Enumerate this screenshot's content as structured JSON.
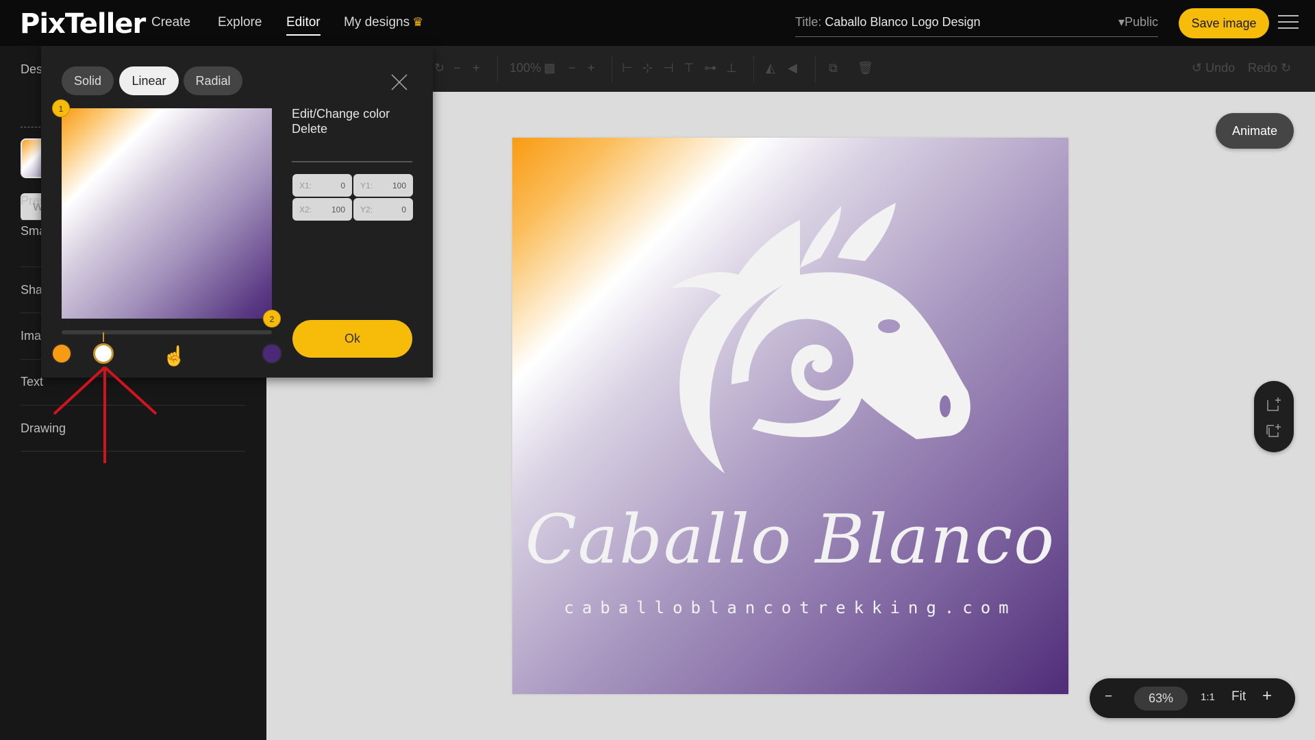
{
  "app": {
    "logo": "PixTeller",
    "nav": [
      "Create",
      "Explore",
      "Editor",
      "My designs"
    ],
    "active_nav": "Editor",
    "title_label": "Title:",
    "title_value": "Caballo Blanco Logo Design",
    "visibility": "Public",
    "save_label": "Save image"
  },
  "toolbar": {
    "zoom_value": "100%",
    "undo_label": "Undo",
    "redo_label": "Redo"
  },
  "sidebar": {
    "design_label": "Des",
    "w_label": "W",
    "items": [
      "Pres",
      "Sma",
      "Sha",
      "Ima",
      "Text",
      "Drawing"
    ]
  },
  "gradient_popup": {
    "tabs": [
      "Solid",
      "Linear",
      "Radial"
    ],
    "active_tab": "Linear",
    "menu": [
      "Edit/Change color",
      "Delete"
    ],
    "coords": {
      "x1_label": "X1:",
      "x1": "0",
      "y1_label": "Y1:",
      "y1": "100",
      "x2_label": "X2:",
      "x2": "100",
      "y2_label": "Y2:",
      "y2": "0"
    },
    "ok_label": "Ok",
    "handle_1": "1",
    "handle_2": "2",
    "stops": [
      {
        "color": "#f99b12",
        "position_percent": 0
      },
      {
        "color": "#ffffff",
        "position_percent": 20,
        "selected": true
      },
      {
        "color": "#4a2a78",
        "position_percent": 100
      }
    ]
  },
  "canvas": {
    "brand_title": "Caballo Blanco",
    "brand_url": "caballoblancotrekking.com",
    "animate_label": "Animate",
    "gradient_colors": [
      "#f99b12",
      "#ffffff",
      "#4f2d78"
    ]
  },
  "zoom_bar": {
    "minus": "−",
    "percent": "63%",
    "one_to_one": "1:1",
    "fit": "Fit",
    "plus": "+"
  },
  "colors": {
    "accent": "#f7bb0a",
    "annotation_arrow": "#d0141e"
  }
}
